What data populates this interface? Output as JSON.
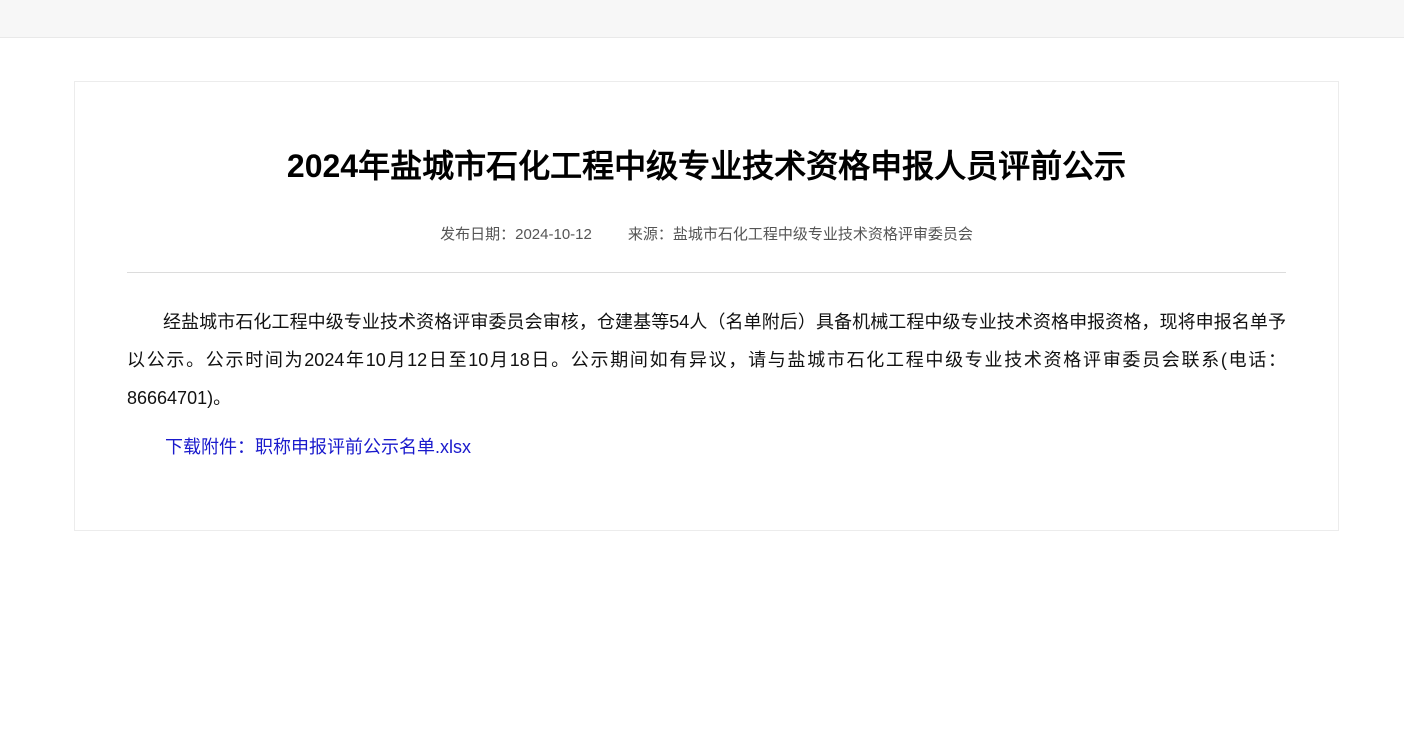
{
  "article": {
    "title": "2024年盐城市石化工程中级专业技术资格申报人员评前公示",
    "publish_date_label": "发布日期：",
    "publish_date": "2024-10-12",
    "source_label": "来源：",
    "source": "盐城市石化工程中级专业技术资格评审委员会",
    "body": "经盐城市石化工程中级专业技术资格评审委员会审核，仓建基等54人（名单附后）具备机械工程中级专业技术资格申报资格，现将申报名单予以公示。公示时间为2024年10月12日至10月18日。公示期间如有异议，请与盐城市石化工程中级专业技术资格评审委员会联系(电话：86664701)。",
    "attachment_label": "下载附件：",
    "attachment_name": "职称申报评前公示名单.xlsx"
  },
  "colors": {
    "link": "#1a1acc",
    "topbar": "#f7f7f7"
  }
}
